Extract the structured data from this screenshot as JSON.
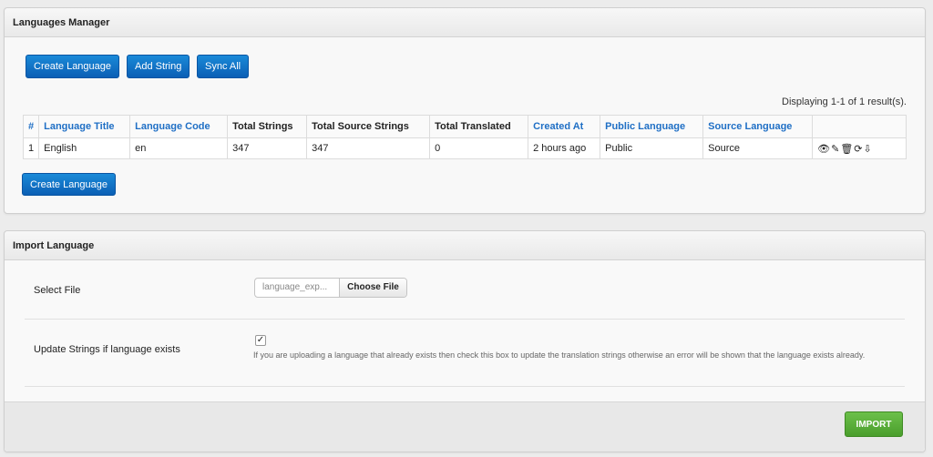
{
  "languages_panel": {
    "title": "Languages Manager",
    "toolbar": {
      "create_language": "Create Language",
      "add_string": "Add String",
      "sync_all": "Sync All"
    },
    "displaying": "Displaying 1-1 of 1 result(s).",
    "columns": [
      "#",
      "Language Title",
      "Language Code",
      "Total Strings",
      "Total Source Strings",
      "Total Translated",
      "Created At",
      "Public Language",
      "Source Language",
      ""
    ],
    "rows": [
      {
        "num": "1",
        "title": "English",
        "code": "en",
        "total_strings": "347",
        "total_source": "347",
        "translated": "0",
        "created": "2 hours ago",
        "public": "Public",
        "source": "Source",
        "actions": {
          "view": "eye-icon",
          "edit": "pencil-icon",
          "delete": "trash-icon",
          "sync": "refresh-icon",
          "export": "download-icon"
        }
      }
    ],
    "bottom_button": "Create Language"
  },
  "import_panel": {
    "title": "Import Language",
    "select_file_label": "Select File",
    "file_value": "language_exp...",
    "choose_file": "Choose File",
    "update_label": "Update Strings if language exists",
    "update_checked": true,
    "help_text": "If you are uploading a language that already exists then check this box to update the translation strings otherwise an error will be shown that the language exists already.",
    "import_button": "IMPORT"
  },
  "colors": {
    "primary_button": "#0b6fc4",
    "link": "#1f6fc5",
    "success_button": "#5aae3a"
  }
}
